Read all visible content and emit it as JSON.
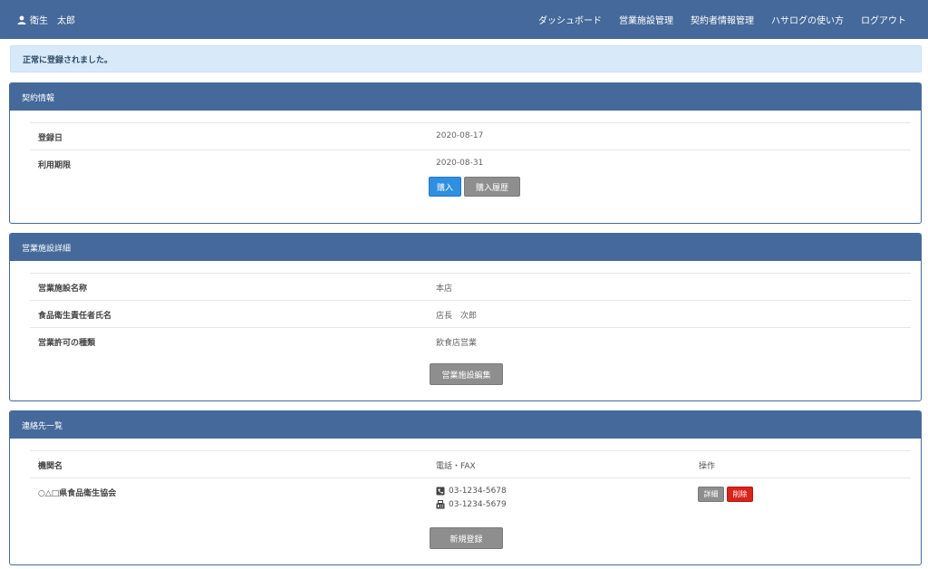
{
  "nav": {
    "user_name": "衛生　太郎",
    "items": [
      "ダッシュボード",
      "営業施設管理",
      "契約者情報管理",
      "ハサログの使い方",
      "ログアウト"
    ]
  },
  "alert": {
    "message": "正常に登録されました。"
  },
  "contract": {
    "title": "契約情報",
    "registered_label": "登録日",
    "registered_value": "2020-08-17",
    "expiry_label": "利用期限",
    "expiry_value": "2020-08-31",
    "buy_button": "購入",
    "history_button": "購入履歴"
  },
  "facility": {
    "title": "営業施設詳細",
    "name_label": "営業施設名称",
    "name_value": "本店",
    "manager_label": "食品衛生責任者氏名",
    "manager_value": "店長　次郎",
    "permit_label": "営業許可の種類",
    "permit_value": "飲食店営業",
    "edit_button": "営業施設編集"
  },
  "contacts": {
    "title": "連絡先一覧",
    "col_org": "機関名",
    "col_phone": "電話・FAX",
    "col_ops": "操作",
    "rows": [
      {
        "org": "○△□県食品衛生協会",
        "phone": "03-1234-5678",
        "fax": "03-1234-5679",
        "detail_button": "詳細",
        "delete_button": "削除"
      }
    ],
    "new_button": "新規登録"
  },
  "colors": {
    "navbar": "#44699a",
    "alert_bg": "#d8eaf9",
    "primary": "#2f8fe0",
    "danger": "#d9231b",
    "secondary": "#8e8e8e"
  }
}
